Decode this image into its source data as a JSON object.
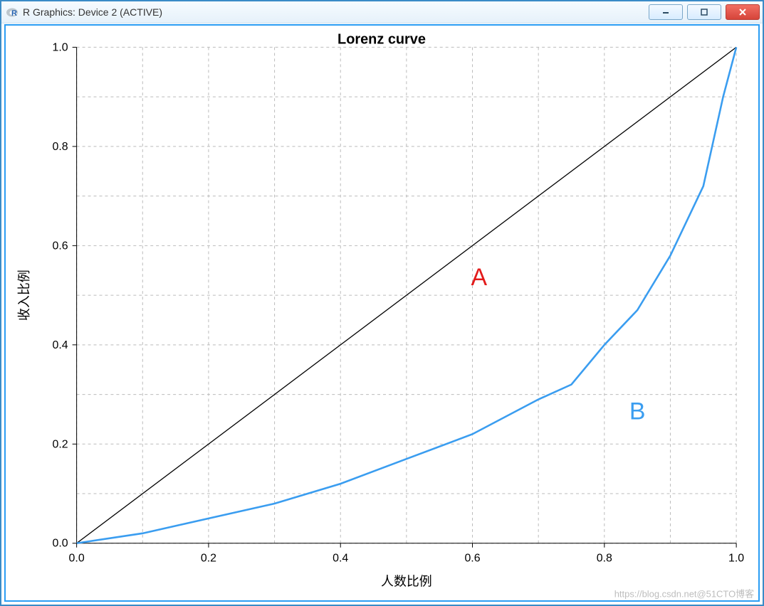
{
  "window": {
    "title": "R Graphics: Device 2 (ACTIVE)",
    "app_icon_alt": "R",
    "min_label": "—",
    "max_label": "□",
    "close_label": "✕"
  },
  "watermark": "https://blog.csdn.net@51CTO博客",
  "chart_data": {
    "type": "line",
    "title": "Lorenz curve",
    "xlabel": "人数比例",
    "ylabel": "收入比例",
    "xlim": [
      0.0,
      1.0
    ],
    "ylim": [
      0.0,
      1.0
    ],
    "x_ticks": [
      0.0,
      0.2,
      0.4,
      0.6,
      0.8,
      1.0
    ],
    "y_ticks": [
      0.0,
      0.2,
      0.4,
      0.6,
      0.8,
      1.0
    ],
    "x_minor": [
      0.1,
      0.3,
      0.5,
      0.7,
      0.9
    ],
    "y_minor": [
      0.1,
      0.3,
      0.5,
      0.7,
      0.9
    ],
    "grid": true,
    "series": [
      {
        "name": "equality_line",
        "color": "#000000",
        "x": [
          0.0,
          1.0
        ],
        "y": [
          0.0,
          1.0
        ]
      },
      {
        "name": "lorenz_curve",
        "color": "#3a9df0",
        "x": [
          0.0,
          0.1,
          0.2,
          0.3,
          0.4,
          0.5,
          0.6,
          0.7,
          0.75,
          0.8,
          0.85,
          0.9,
          0.95,
          0.98,
          1.0
        ],
        "y": [
          0.0,
          0.02,
          0.05,
          0.08,
          0.12,
          0.17,
          0.22,
          0.29,
          0.32,
          0.4,
          0.47,
          0.58,
          0.72,
          0.9,
          1.0
        ]
      }
    ],
    "annotations": [
      {
        "label": "A",
        "x": 0.61,
        "y": 0.52,
        "color": "#e31b1b"
      },
      {
        "label": "B",
        "x": 0.85,
        "y": 0.25,
        "color": "#3a9df0"
      }
    ]
  }
}
